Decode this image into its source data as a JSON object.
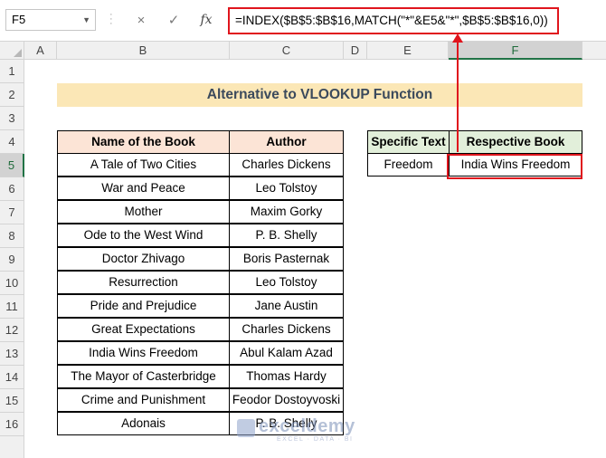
{
  "formula_bar": {
    "name_box": "F5",
    "cancel_icon": "×",
    "enter_icon": "✓",
    "fx_label": "fx",
    "formula": "=INDEX($B$5:$B$16,MATCH(\"*\"&E5&\"*\",$B$5:$B$16,0))"
  },
  "columns": [
    "A",
    "B",
    "C",
    "D",
    "E",
    "F"
  ],
  "rows": [
    "1",
    "2",
    "3",
    "4",
    "5",
    "6",
    "7",
    "8",
    "9",
    "10",
    "11",
    "12",
    "13",
    "14",
    "15",
    "16"
  ],
  "title": "Alternative to VLOOKUP Function",
  "book_table": {
    "headers": [
      "Name of the Book",
      "Author"
    ],
    "rows": [
      [
        "A Tale of Two Cities",
        "Charles Dickens"
      ],
      [
        "War and Peace",
        "Leo Tolstoy"
      ],
      [
        "Mother",
        "Maxim Gorky"
      ],
      [
        "Ode to the West Wind",
        "P. B. Shelly"
      ],
      [
        "Doctor Zhivago",
        "Boris Pasternak"
      ],
      [
        "Resurrection",
        "Leo Tolstoy"
      ],
      [
        "Pride and Prejudice",
        "Jane Austin"
      ],
      [
        "Great Expectations",
        "Charles Dickens"
      ],
      [
        "India Wins Freedom",
        "Abul Kalam Azad"
      ],
      [
        "The Mayor of Casterbridge",
        "Thomas Hardy"
      ],
      [
        "Crime and Punishment",
        "Feodor Dostoyvoski"
      ],
      [
        "Adonais",
        "P. B. Shelly"
      ]
    ]
  },
  "lookup_table": {
    "headers": [
      "Specific Text",
      "Respective Book"
    ],
    "row": [
      "Freedom",
      "India Wins Freedom"
    ]
  },
  "colors": {
    "title_fill": "#fbe7b6",
    "book_header_fill": "#fce4d6",
    "lookup_header_fill": "#e2efda",
    "highlight": "#e0151d"
  },
  "watermark": {
    "name": "exceldemy",
    "tagline": "EXCEL · DATA · BI"
  }
}
